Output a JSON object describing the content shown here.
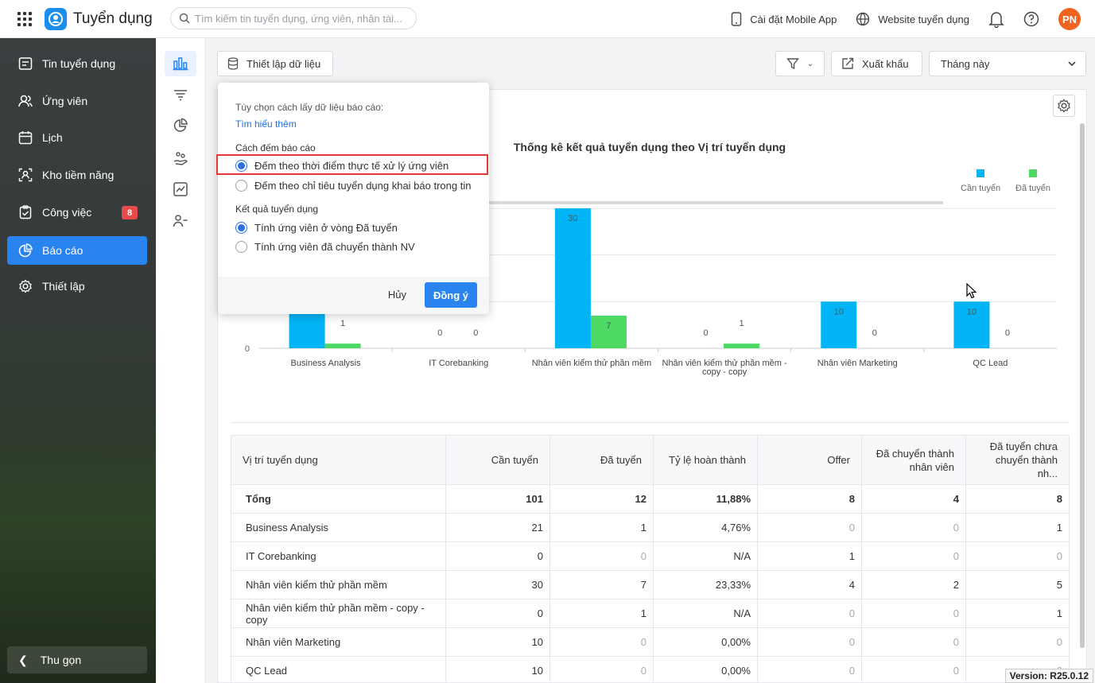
{
  "app": {
    "title": "Tuyển dụng"
  },
  "search": {
    "placeholder": "Tìm kiếm tin tuyển dụng, ứng viên, nhân tài..."
  },
  "topbar": {
    "mobile_app": "Cài đặt Mobile App",
    "website": "Website tuyển dụng",
    "avatar_initials": "PN"
  },
  "sidebar": {
    "items": [
      {
        "label": "Tin tuyển dụng"
      },
      {
        "label": "Ứng viên"
      },
      {
        "label": "Lịch"
      },
      {
        "label": "Kho tiềm năng"
      },
      {
        "label": "Công việc",
        "badge": "8"
      },
      {
        "label": "Báo cáo",
        "active": true
      },
      {
        "label": "Thiết lập"
      }
    ],
    "collapse_label": "Thu gọn"
  },
  "toolbar": {
    "data_setup": "Thiết lập dữ liệu",
    "export": "Xuất khẩu",
    "period": "Tháng này"
  },
  "popover": {
    "hint": "Tùy chọn cách lấy dữ liệu báo cáo:",
    "learn_more": "Tìm hiểu thêm",
    "count_section": "Cách đếm báo cáo",
    "count_options": [
      {
        "label": "Đếm theo thời điểm thực tế xử lý ứng viên",
        "selected": true
      },
      {
        "label": "Đếm theo chỉ tiêu tuyển dụng khai báo trong tin",
        "selected": false
      }
    ],
    "result_section": "Kết quả tuyển dụng",
    "result_options": [
      {
        "label": "Tính ứng viên ở vòng Đã tuyển",
        "selected": true
      },
      {
        "label": "Tính ứng viên đã chuyển thành NV",
        "selected": false
      }
    ],
    "cancel": "Hủy",
    "ok": "Đồng ý"
  },
  "chart_data": {
    "type": "bar",
    "title": "Thống kê kết quả tuyển dụng theo Vị trí tuyển dụng",
    "categories": [
      "Business Analysis",
      "IT Corebanking",
      "Nhân viên kiểm thử phần mềm",
      "Nhân viên kiểm thử phần mềm - copy - copy",
      "Nhân viên Marketing",
      "QC Lead"
    ],
    "series": [
      {
        "name": "Cần tuyển",
        "color": "#00b4f5",
        "values": [
          21,
          0,
          30,
          0,
          10,
          10
        ]
      },
      {
        "name": "Đã tuyển",
        "color": "#4cd964",
        "values": [
          1,
          0,
          7,
          1,
          0,
          0
        ]
      }
    ],
    "ylim": [
      0,
      30
    ],
    "yticks": [
      "0"
    ],
    "legend": "top-right",
    "grid": true
  },
  "table": {
    "headers": [
      "Vị trí tuyển dụng",
      "Cần tuyển",
      "Đã tuyển",
      "Tỷ lệ hoàn thành",
      "Offer",
      "Đã chuyển thành nhân viên",
      "Đã tuyển chưa chuyển thành nh..."
    ],
    "rows": [
      [
        "Tổng",
        "101",
        "12",
        "11,88%",
        "8",
        "4",
        "8"
      ],
      [
        "Business Analysis",
        "21",
        "1",
        "4,76%",
        "0",
        "0",
        "1"
      ],
      [
        "IT Corebanking",
        "0",
        "0",
        "N/A",
        "1",
        "0",
        "0"
      ],
      [
        "Nhân viên kiểm thử phần mềm",
        "30",
        "7",
        "23,33%",
        "4",
        "2",
        "5"
      ],
      [
        "Nhân viên kiểm thử phần mềm - copy - copy",
        "0",
        "1",
        "N/A",
        "0",
        "0",
        "1"
      ],
      [
        "Nhân viên Marketing",
        "10",
        "0",
        "0,00%",
        "0",
        "0",
        "0"
      ],
      [
        "QC Lead",
        "10",
        "0",
        "0,00%",
        "0",
        "0",
        "0"
      ]
    ]
  },
  "version": "Version: R25.0.12"
}
